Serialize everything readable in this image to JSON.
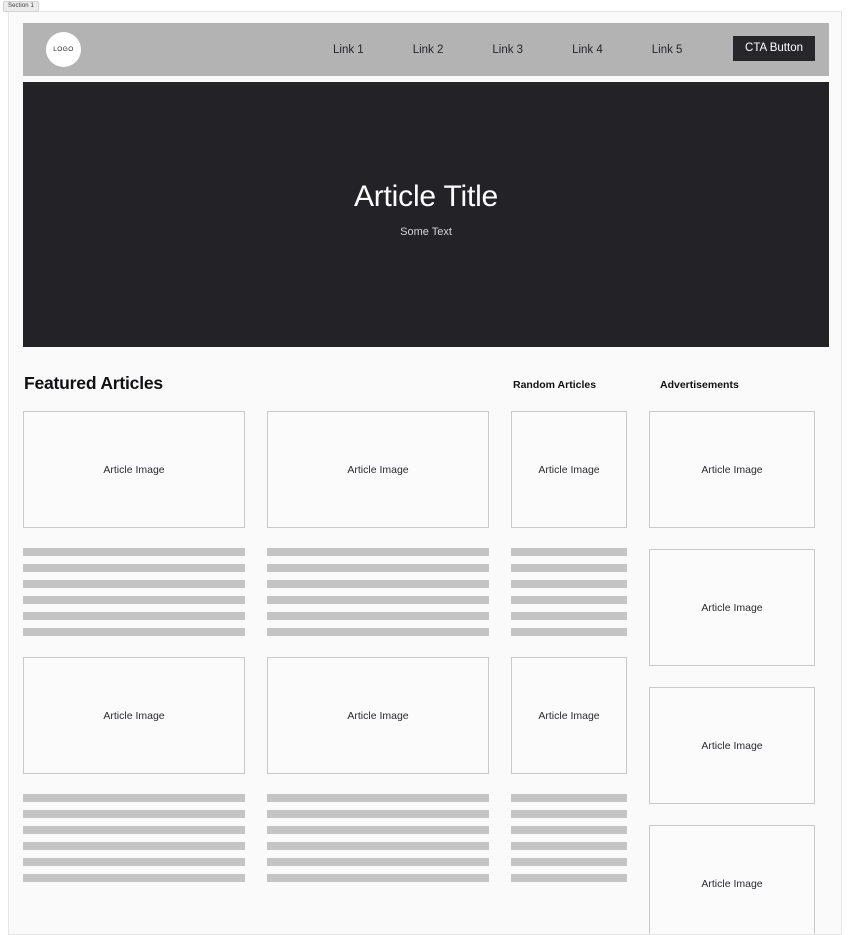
{
  "section_label": "Section 1",
  "navbar": {
    "logo_text": "LOGO",
    "links": [
      {
        "label": "Link 1"
      },
      {
        "label": "Link 2"
      },
      {
        "label": "Link 3"
      },
      {
        "label": "Link 4"
      },
      {
        "label": "Link 5"
      }
    ],
    "cta_label": "CTA Button",
    "background_color": "#b3b3b3",
    "cta_background_color": "#26262b"
  },
  "hero": {
    "title": "Article Title",
    "subtitle": "Some Text",
    "background_color": "#232327",
    "title_color": "#ffffff"
  },
  "content": {
    "heading_featured": "Featured Articles",
    "heading_random": "Random Articles",
    "heading_advertisements": "Advertisements",
    "image_placeholder_label": "Article Image",
    "columns": {
      "featured_a": {
        "items": [
          {
            "image_label": "Article Image",
            "bars": 6
          },
          {
            "image_label": "Article Image",
            "bars": 6
          }
        ]
      },
      "featured_b": {
        "items": [
          {
            "image_label": "Article Image",
            "bars": 6
          },
          {
            "image_label": "Article Image",
            "bars": 6
          }
        ]
      },
      "random": {
        "items": [
          {
            "image_label": "Article Image",
            "bars": 6
          },
          {
            "image_label": "Article Image",
            "bars": 6
          }
        ]
      },
      "advertisements": {
        "items": [
          {
            "image_label": "Article Image"
          },
          {
            "image_label": "Article Image"
          },
          {
            "image_label": "Article Image"
          },
          {
            "image_label": "Article Image"
          }
        ]
      }
    }
  }
}
